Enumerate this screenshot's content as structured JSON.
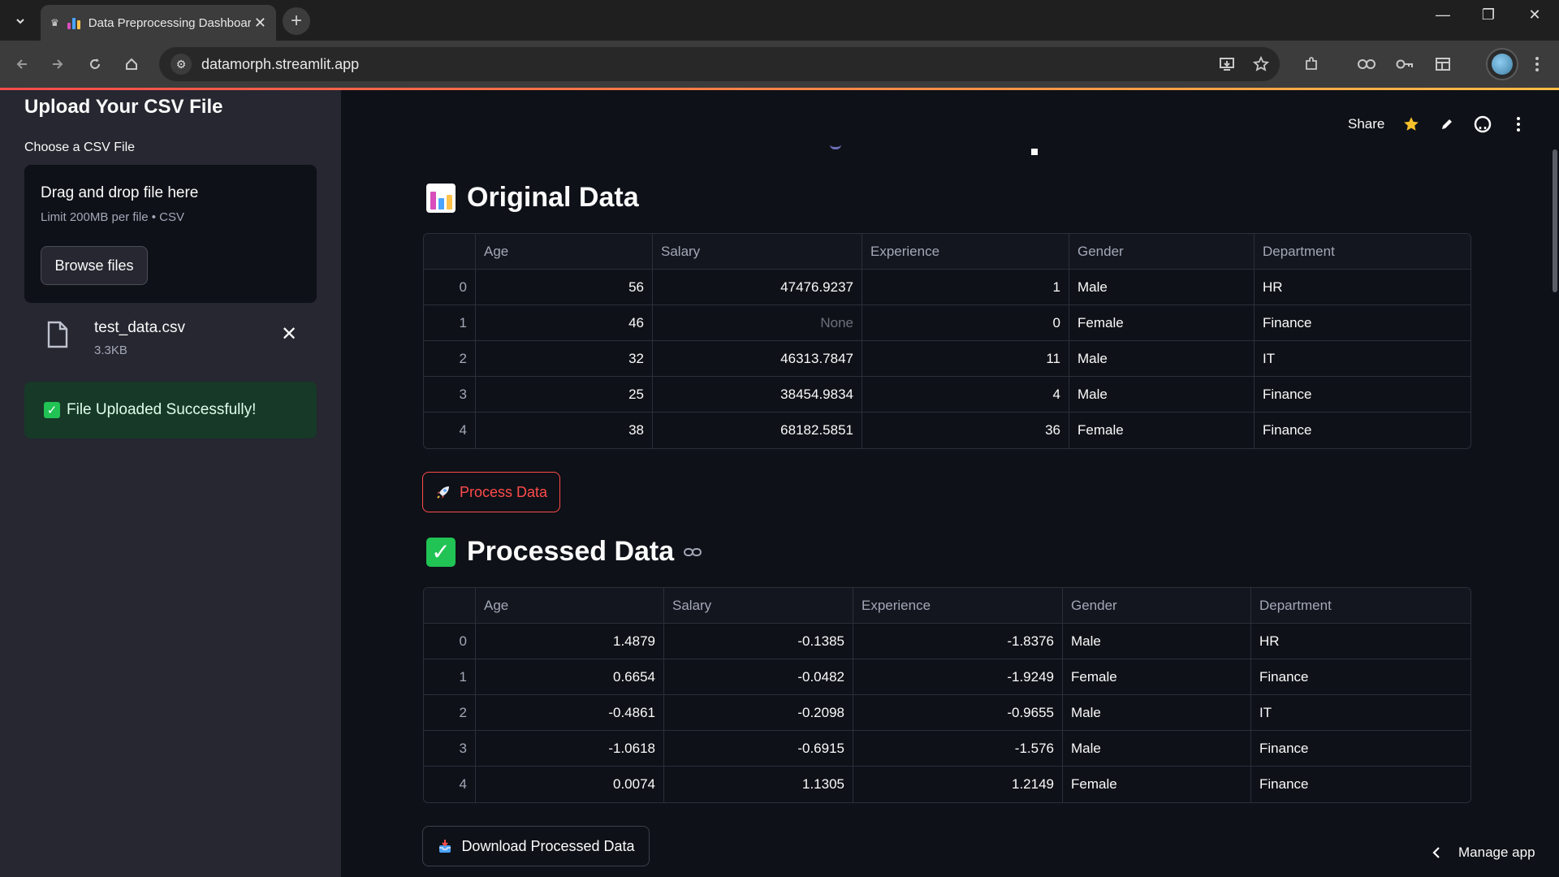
{
  "browser": {
    "tab_title": "Data Preprocessing Dashboard",
    "url": "datamorph.streamlit.app",
    "new_tab": "+",
    "minimize": "—",
    "restore": "❐",
    "close": "✕"
  },
  "header": {
    "share_label": "Share"
  },
  "sidebar": {
    "title": "Upload Your CSV File",
    "uploader_label": "Choose a CSV File",
    "drop_title": "Drag and drop file here",
    "drop_limit": "Limit 200MB per file • CSV",
    "browse_label": "Browse files",
    "file_name": "test_data.csv",
    "file_size": "3.3KB",
    "success_message": "File Uploaded Successfully!"
  },
  "main": {
    "original_title": "Original Data",
    "process_button": "Process Data",
    "processed_title": "Processed Data",
    "download_button": "Download Processed Data",
    "manage_app": "Manage app"
  },
  "original_table": {
    "columns": [
      "Age",
      "Salary",
      "Experience",
      "Gender",
      "Department"
    ],
    "rows": [
      {
        "idx": "0",
        "Age": "56",
        "Salary": "47476.9237",
        "Experience": "1",
        "Gender": "Male",
        "Department": "HR"
      },
      {
        "idx": "1",
        "Age": "46",
        "Salary": "None",
        "Experience": "0",
        "Gender": "Female",
        "Department": "Finance"
      },
      {
        "idx": "2",
        "Age": "32",
        "Salary": "46313.7847",
        "Experience": "11",
        "Gender": "Male",
        "Department": "IT"
      },
      {
        "idx": "3",
        "Age": "25",
        "Salary": "38454.9834",
        "Experience": "4",
        "Gender": "Male",
        "Department": "Finance"
      },
      {
        "idx": "4",
        "Age": "38",
        "Salary": "68182.5851",
        "Experience": "36",
        "Gender": "Female",
        "Department": "Finance"
      }
    ]
  },
  "processed_table": {
    "columns": [
      "Age",
      "Salary",
      "Experience",
      "Gender",
      "Department"
    ],
    "rows": [
      {
        "idx": "0",
        "Age": "1.4879",
        "Salary": "-0.1385",
        "Experience": "-1.8376",
        "Gender": "Male",
        "Department": "HR"
      },
      {
        "idx": "1",
        "Age": "0.6654",
        "Salary": "-0.0482",
        "Experience": "-1.9249",
        "Gender": "Female",
        "Department": "Finance"
      },
      {
        "idx": "2",
        "Age": "-0.4861",
        "Salary": "-0.2098",
        "Experience": "-0.9655",
        "Gender": "Male",
        "Department": "IT"
      },
      {
        "idx": "3",
        "Age": "-1.0618",
        "Salary": "-0.6915",
        "Experience": "-1.576",
        "Gender": "Male",
        "Department": "Finance"
      },
      {
        "idx": "4",
        "Age": "0.0074",
        "Salary": "1.1305",
        "Experience": "1.2149",
        "Gender": "Female",
        "Department": "Finance"
      }
    ]
  },
  "colors": {
    "accent": "#ff4b4b",
    "success_bg": "#173928",
    "success": "#21c354",
    "sidebar_bg": "#262730",
    "main_bg": "#0e1117"
  },
  "icons": {
    "tab_search": "chevron-down-icon",
    "favicon": "bar-chart-icon",
    "section_original": "bar-chart-emoji",
    "section_processed": "check-mark-emoji",
    "process": "rocket-icon",
    "download": "inbox-tray-icon"
  }
}
